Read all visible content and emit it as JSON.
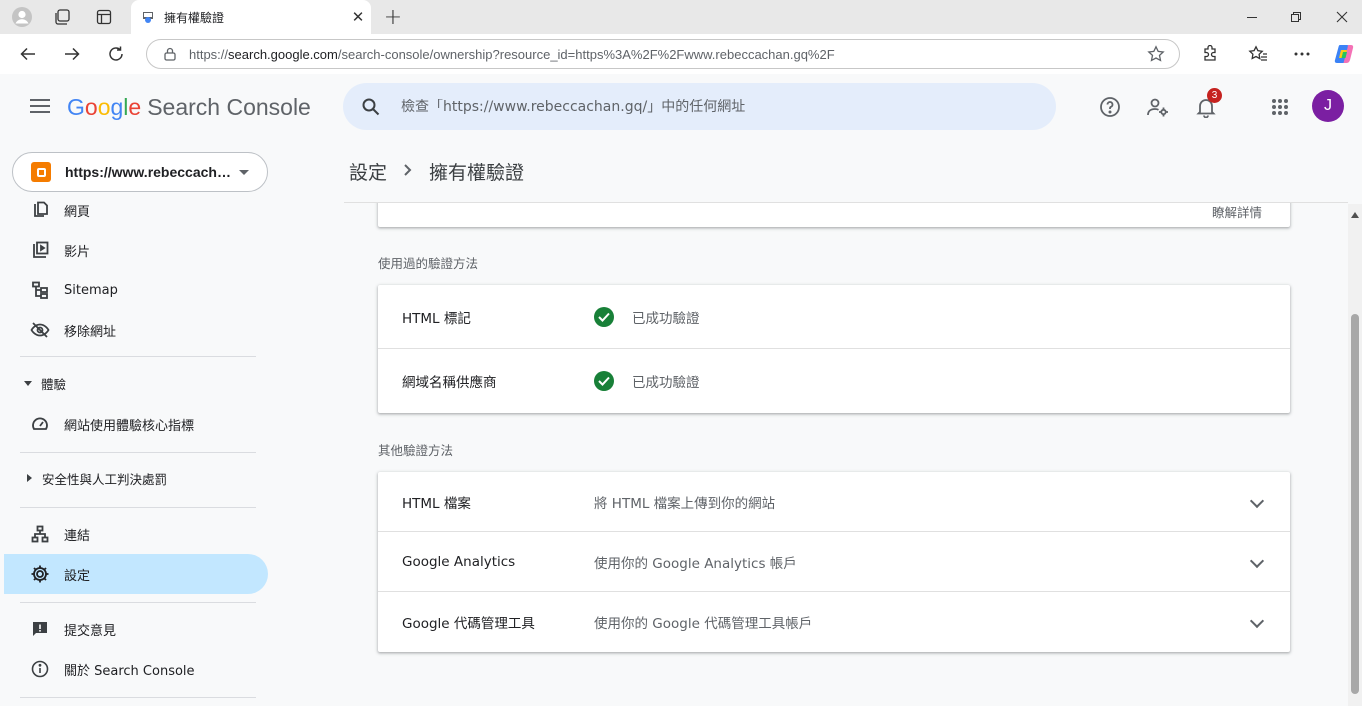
{
  "browser": {
    "tab_title": "擁有權驗證",
    "tab_close": "✕",
    "newtab": "+",
    "url_prefix": "https://",
    "url_host": "search.google.com",
    "url_rest": "/search-console/ownership?resource_id=https%3A%2F%2Fwww.rebeccachan.gq%2F"
  },
  "header": {
    "brand": [
      "G",
      "o",
      "o",
      "g",
      "l",
      "e"
    ],
    "product": "Search Console",
    "search_placeholder": "檢查「https://www.rebeccachan.gq/」中的任何網址",
    "notification_count": "3",
    "avatar_letter": "J"
  },
  "sidebar": {
    "property": "https://www.rebeccachan.gq/",
    "items": [
      {
        "label": "網頁",
        "icon": "pages-icon"
      },
      {
        "label": "影片",
        "icon": "video-icon"
      },
      {
        "label": "Sitemap",
        "icon": "sitemap-icon"
      },
      {
        "label": "移除網址",
        "icon": "removals-icon"
      }
    ],
    "section_experience": "體驗",
    "cwv": "網站使用體驗核心指標",
    "section_security": "安全性與人工判決處罰",
    "links": "連結",
    "settings": "設定",
    "feedback": "提交意見",
    "about": "關於 Search Console"
  },
  "breadcrumb": {
    "parent": "設定",
    "current": "擁有權驗證"
  },
  "main": {
    "partial_text": "瞭解詳情",
    "used_methods_label": "使用過的驗證方法",
    "used_methods": [
      {
        "title": "HTML 標記",
        "status": "已成功驗證"
      },
      {
        "title": "網域名稱供應商",
        "status": "已成功驗證"
      }
    ],
    "other_methods_label": "其他驗證方法",
    "other_methods": [
      {
        "title": "HTML 檔案",
        "desc": "將 HTML 檔案上傳到你的網站"
      },
      {
        "title": "Google Analytics",
        "desc": "使用你的 Google Analytics 帳戶"
      },
      {
        "title": "Google 代碼管理工具",
        "desc": "使用你的 Google 代碼管理工具帳戶"
      }
    ]
  },
  "colors": {
    "active_nav": "#c2e7ff",
    "search_bg": "#e4edfb",
    "check_green": "#188038",
    "avatar": "#7b1fa2"
  }
}
